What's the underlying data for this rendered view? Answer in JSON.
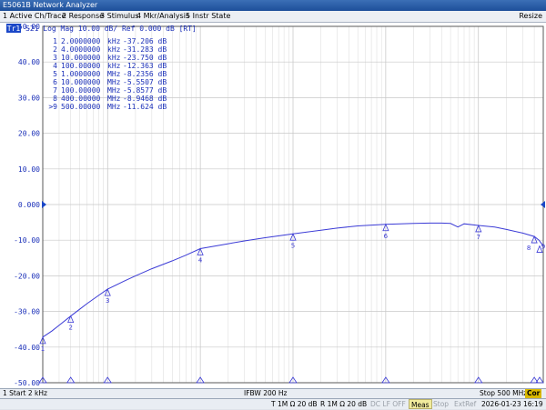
{
  "window": {
    "title": "E5061B Network Analyzer"
  },
  "menu": {
    "items": [
      "1 Active Ch/Trace",
      "2 Response",
      "3 Stimulus",
      "4 Mkr/Analysis",
      "5 Instr State"
    ],
    "resize": "Resize"
  },
  "trace": {
    "badge": "Tr1",
    "header": "S21 Log Mag 10.00 dB/ Ref 0.000 dB [RT]"
  },
  "y_axis": {
    "ticks": [
      "50.00",
      "40.00",
      "30.00",
      "20.00",
      "10.00",
      "0.000",
      "-10.00",
      "-20.00",
      "-30.00",
      "-40.00",
      "-50.00"
    ]
  },
  "markers": [
    {
      "num": "1",
      "freq": "2.0000000",
      "unit": "kHz",
      "value": "-37.206 dB",
      "label": "1",
      "fhz": 2000,
      "db": -37.206
    },
    {
      "num": "2",
      "freq": "4.0000000",
      "unit": "kHz",
      "value": "-31.283 dB",
      "label": "2",
      "fhz": 4000,
      "db": -31.283
    },
    {
      "num": "3",
      "freq": "10.000000",
      "unit": "kHz",
      "value": "-23.750 dB",
      "label": "3",
      "fhz": 10000,
      "db": -23.75
    },
    {
      "num": "4",
      "freq": "100.00000",
      "unit": "kHz",
      "value": "-12.363 dB",
      "label": "4",
      "fhz": 100000,
      "db": -12.363
    },
    {
      "num": "5",
      "freq": "1.0000000",
      "unit": "MHz",
      "value": "-8.2356 dB",
      "label": "5",
      "fhz": 1000000,
      "db": -8.2356
    },
    {
      "num": "6",
      "freq": "10.000000",
      "unit": "MHz",
      "value": "-5.5507 dB",
      "label": "6",
      "fhz": 10000000,
      "db": -5.5507
    },
    {
      "num": "7",
      "freq": "100.00000",
      "unit": "MHz",
      "value": "-5.8577 dB",
      "label": "7",
      "fhz": 100000000,
      "db": -5.8577
    },
    {
      "num": "8",
      "freq": "400.00000",
      "unit": "MHz",
      "value": "-8.9468 dB",
      "label": "8",
      "fhz": 400000000,
      "db": -8.9468
    },
    {
      "num": ">9",
      "freq": "500.00000",
      "unit": "MHz",
      "value": "-11.624 dB",
      "label": "9",
      "fhz": 500000000,
      "db": -11.624
    }
  ],
  "status": {
    "start": "1  Start 2 kHz",
    "ifbw": "IFBW 200 Hz",
    "stop": "Stop 500 MHz",
    "cor": "Cor"
  },
  "bottom": {
    "t": "T 1M Ω 20 dB",
    "r": "R 1M Ω 20 dB",
    "dclf": "DC LF OFF",
    "meas": "Meas",
    "stop": "Stop",
    "extref": "ExtRef",
    "datetime": "2026-01-23 16:19"
  },
  "chart_data": {
    "type": "line",
    "xscale": "log",
    "x_range_hz": [
      2000,
      500000000
    ],
    "ylim": [
      -50,
      50
    ],
    "y_step": 10,
    "grid": true,
    "trace_color": "#3b3bd6",
    "series": [
      {
        "x_hz": [
          2000,
          2500,
          3000,
          4000,
          5000,
          6000,
          8000,
          10000,
          15000,
          20000,
          30000,
          50000,
          70000,
          100000,
          200000,
          300000,
          500000,
          1000000,
          2000000,
          3000000,
          5000000,
          10000000,
          20000000,
          30000000,
          40000000,
          50000000,
          60000000,
          70000000,
          100000000,
          150000000,
          200000000,
          300000000,
          400000000,
          450000000,
          500000000
        ],
        "db": [
          -37.2,
          -35.5,
          -33.9,
          -31.3,
          -29.4,
          -27.8,
          -25.5,
          -23.75,
          -21.5,
          -20.0,
          -18.0,
          -15.8,
          -14.2,
          -12.36,
          -11.0,
          -10.2,
          -9.3,
          -8.24,
          -7.2,
          -6.6,
          -6.0,
          -5.55,
          -5.3,
          -5.2,
          -5.2,
          -5.3,
          -6.3,
          -5.4,
          -5.86,
          -6.3,
          -7.0,
          -8.0,
          -8.95,
          -10.0,
          -11.62
        ]
      }
    ]
  }
}
